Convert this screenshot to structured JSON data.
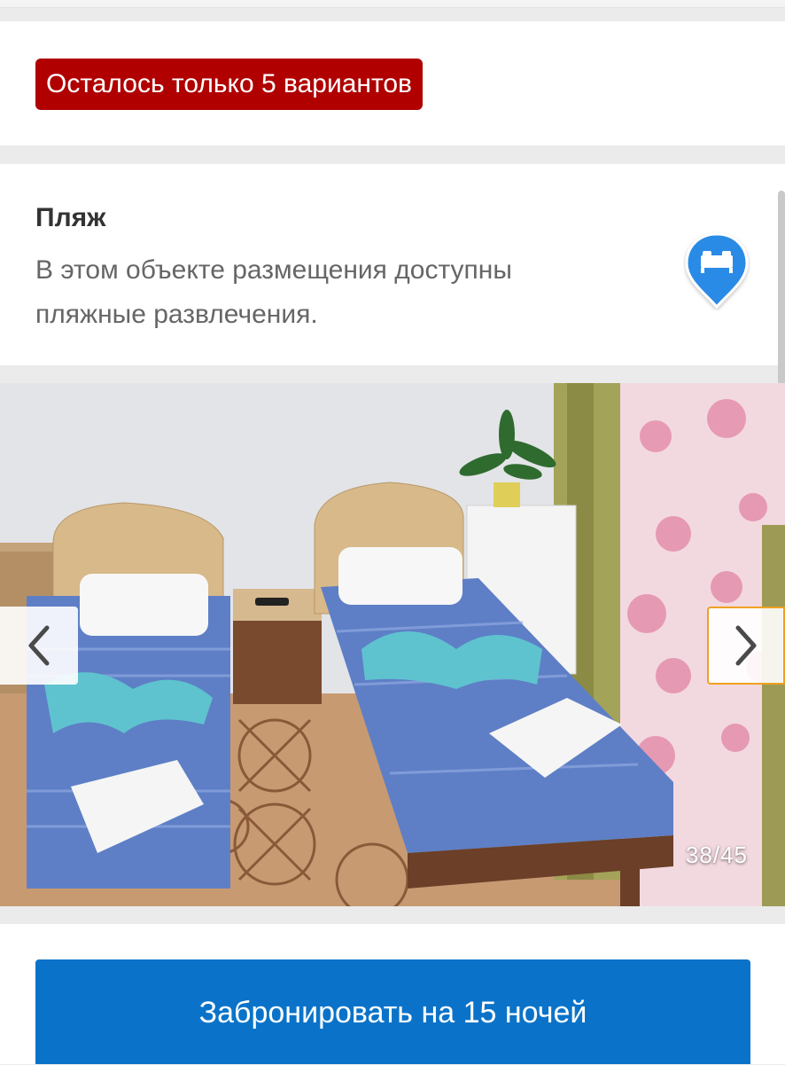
{
  "urgency": {
    "badge_text": "Осталось только 5 вариантов",
    "badge_color": "#b00000"
  },
  "feature": {
    "title": "Пляж",
    "description": "В этом объекте размещения доступны пляжные развлечения.",
    "icon": "bed-pin-icon",
    "icon_color": "#2b8be6"
  },
  "gallery": {
    "counter": "38/45",
    "prev_icon": "chevron-left-icon",
    "next_icon": "chevron-right-icon"
  },
  "cta": {
    "book_label": "Забронировать на 15 ночей",
    "button_color": "#0a73c9"
  }
}
